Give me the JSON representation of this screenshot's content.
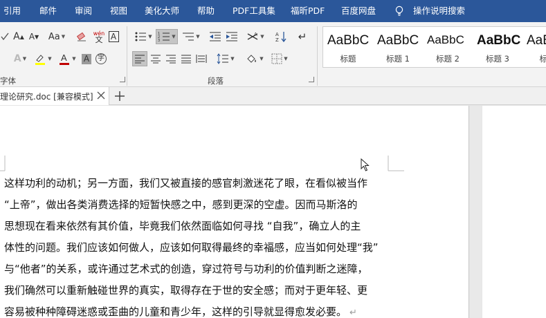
{
  "menu": {
    "items": [
      "引用",
      "邮件",
      "审阅",
      "视图",
      "美化大师",
      "帮助",
      "PDF工具集",
      "福昕PDF",
      "百度网盘"
    ],
    "tell_me": "操作说明搜索"
  },
  "ribbon": {
    "font_group_label": "字体",
    "paragraph_group_label": "段落",
    "wen_glyph": "wén\n文",
    "font_color": "#c00000",
    "highlight_color": "#ffff00",
    "styles": [
      {
        "sample": "AaBbC",
        "name": "标题"
      },
      {
        "sample": "AaBbC",
        "name": "标题 1"
      },
      {
        "sample": "AaBbC",
        "name": "标题 2"
      },
      {
        "sample": "AaBbC",
        "name": "标题 3"
      },
      {
        "sample": "AaBb",
        "name": "标题"
      }
    ]
  },
  "tab": {
    "title": "理论研究.doc [兼容模式]"
  },
  "document": {
    "lines": [
      "这样功利的动机；另一方面，我们又被直接的感官刺激迷花了眼，在看似被当作",
      "“上帝”，做出各类消费选择的短暂快感之中，感到更深的空虚。因而马斯洛的",
      "思想现在看来依然有其价值，毕竟我们依然面临如何寻找 “自我”，确立人的主",
      "体性的问题。我们应该如何做人，应该如何取得最终的幸福感，应当如何处理“我”",
      "与“他者”的关系，或许通过艺术式的创造，穿过符号与功利的价值判断之迷障，",
      "我们确然可以重新触碰世界的真实，取得存在于世的安全感；而对于更年轻、更",
      "容易被种种障碍迷惑或歪曲的儿童和青少年，这样的引导就显得愈发必要。"
    ],
    "paragraph_mark": "↵"
  },
  "colors": {
    "menubar": "#2b579a",
    "ribbon": "#f3f3f3",
    "page": "#ffffff"
  }
}
